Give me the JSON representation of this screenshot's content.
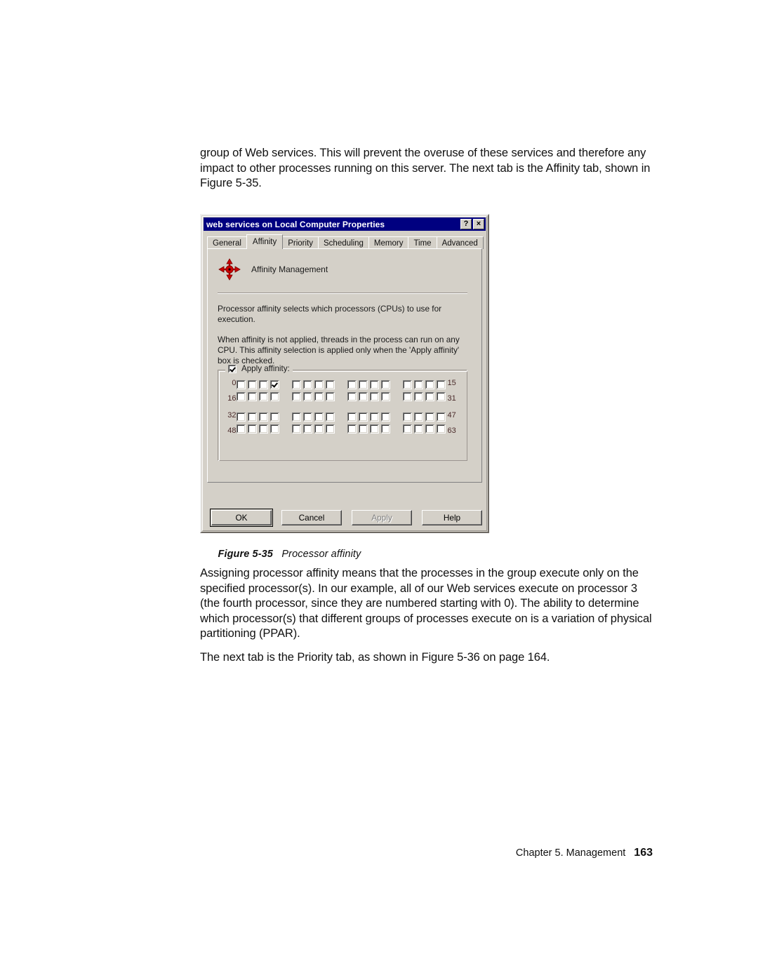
{
  "page": {
    "paragraph_1": "group of Web services. This will prevent the overuse of these services and therefore any impact to other processes running on this server. The next tab is the Affinity tab, shown in Figure 5-35.",
    "paragraph_2": "Assigning processor affinity means that the processes in the group execute only on the specified processor(s). In our example, all of our Web services execute on processor 3 (the fourth processor, since they are numbered starting with 0). The ability to determine which processor(s) that different groups of processes execute on is a variation of physical partitioning (PPAR).",
    "paragraph_3": "The next tab is the Priority tab, as shown in Figure 5-36 on page 164.",
    "figure_caption_number": "Figure 5-35",
    "figure_caption_title": "Processor affinity",
    "footer_chapter": "Chapter 5. Management",
    "footer_page": "163"
  },
  "dialog": {
    "title": "web services on Local Computer Properties",
    "titlebar_color": "#000080",
    "face_color": "#d4d0c8",
    "help_button": "?",
    "close_button": "×",
    "tabs": [
      {
        "label": "General",
        "selected": false
      },
      {
        "label": "Affinity",
        "selected": true
      },
      {
        "label": "Priority",
        "selected": false
      },
      {
        "label": "Scheduling",
        "selected": false
      },
      {
        "label": "Memory",
        "selected": false
      },
      {
        "label": "Time",
        "selected": false
      },
      {
        "label": "Advanced",
        "selected": false
      }
    ],
    "header_label": "Affinity Management",
    "icon_color": "#cc0000",
    "description_1": "Processor affinity selects which processors (CPUs) to use for execution.",
    "description_2": "When affinity is not applied, threads in the process can run on any CPU. This affinity selection is applied only when the 'Apply affinity' box is checked.",
    "groupbox": {
      "legend": "Apply affinity:",
      "legend_checked": true,
      "rows": [
        {
          "start": "0",
          "end": "15",
          "checked_indexes": [
            3
          ]
        },
        {
          "start": "16",
          "end": "31",
          "checked_indexes": []
        },
        {
          "start": "32",
          "end": "47",
          "checked_indexes": []
        },
        {
          "start": "48",
          "end": "63",
          "checked_indexes": []
        }
      ]
    },
    "buttons": [
      {
        "label": "OK",
        "default": true,
        "disabled": false
      },
      {
        "label": "Cancel",
        "default": false,
        "disabled": false
      },
      {
        "label": "Apply",
        "default": false,
        "disabled": true
      },
      {
        "label": "Help",
        "default": false,
        "disabled": false
      }
    ]
  }
}
